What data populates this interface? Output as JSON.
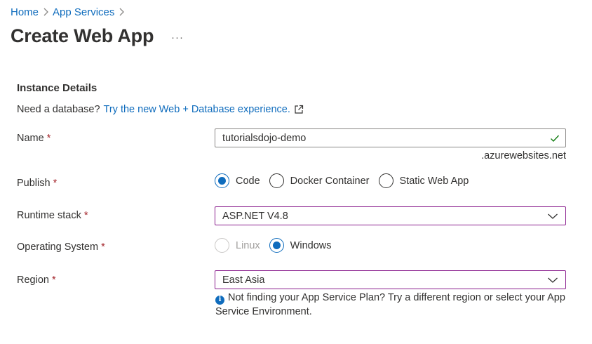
{
  "breadcrumb": {
    "items": [
      {
        "label": "Home"
      },
      {
        "label": "App Services"
      }
    ]
  },
  "page": {
    "title": "Create Web App",
    "more_label": "···"
  },
  "instance_details": {
    "title": "Instance Details",
    "database_prompt": "Need a database?",
    "database_link": "Try the new Web + Database experience."
  },
  "form": {
    "name": {
      "label": "Name",
      "required": "*",
      "value": "tutorialsdojo-demo",
      "suffix": ".azurewebsites.net",
      "valid": true
    },
    "publish": {
      "label": "Publish",
      "required": "*",
      "options": [
        {
          "label": "Code",
          "checked": true
        },
        {
          "label": "Docker Container",
          "checked": false
        },
        {
          "label": "Static Web App",
          "checked": false
        }
      ]
    },
    "runtime_stack": {
      "label": "Runtime stack",
      "required": "*",
      "value": "ASP.NET V4.8"
    },
    "operating_system": {
      "label": "Operating System",
      "required": "*",
      "options": [
        {
          "label": "Linux",
          "checked": false,
          "disabled": true
        },
        {
          "label": "Windows",
          "checked": true,
          "disabled": false
        }
      ]
    },
    "region": {
      "label": "Region",
      "required": "*",
      "value": "East Asia",
      "info_text": "Not finding your App Service Plan? Try a different region or select your App Service Environment."
    }
  },
  "icons": {
    "chevron": "chevron-right-icon",
    "external": "external-link-icon",
    "check": "checkmark-icon",
    "dropdown": "chevron-down-icon",
    "info": "info-icon"
  },
  "colors": {
    "link": "#0f6cbd",
    "required": "#a4262c",
    "valid": "#107c10",
    "select_border": "#8a1f8e"
  }
}
